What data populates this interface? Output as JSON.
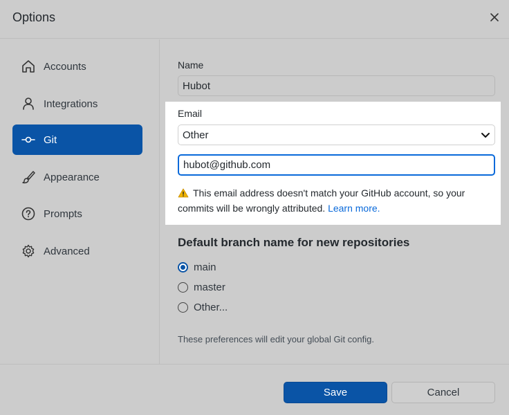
{
  "dialog": {
    "title": "Options"
  },
  "sidebar": {
    "items": [
      {
        "label": "Accounts",
        "icon": "home-icon",
        "active": false
      },
      {
        "label": "Integrations",
        "icon": "person-icon",
        "active": false
      },
      {
        "label": "Git",
        "icon": "git-commit-icon",
        "active": true
      },
      {
        "label": "Appearance",
        "icon": "paintbrush-icon",
        "active": false
      },
      {
        "label": "Prompts",
        "icon": "question-icon",
        "active": false
      },
      {
        "label": "Advanced",
        "icon": "gear-icon",
        "active": false
      }
    ]
  },
  "git": {
    "name_label": "Name",
    "name_value": "Hubot",
    "email_label": "Email",
    "email_select_value": "Other",
    "email_value": "hubot@github.com",
    "warning_text": "This email address doesn't match your GitHub account, so your commits will be wrongly attributed.",
    "learn_more": "Learn more.",
    "branch_section_title": "Default branch name for new repositories",
    "branch_options": [
      {
        "label": "main",
        "checked": true
      },
      {
        "label": "master",
        "checked": false
      },
      {
        "label": "Other...",
        "checked": false
      }
    ],
    "note": "These preferences will edit your global Git config."
  },
  "footer": {
    "save_label": "Save",
    "cancel_label": "Cancel"
  },
  "colors": {
    "accent": "#0a54a6",
    "link": "#0969da",
    "background": "#cccccc",
    "warning": "#f0b400"
  }
}
